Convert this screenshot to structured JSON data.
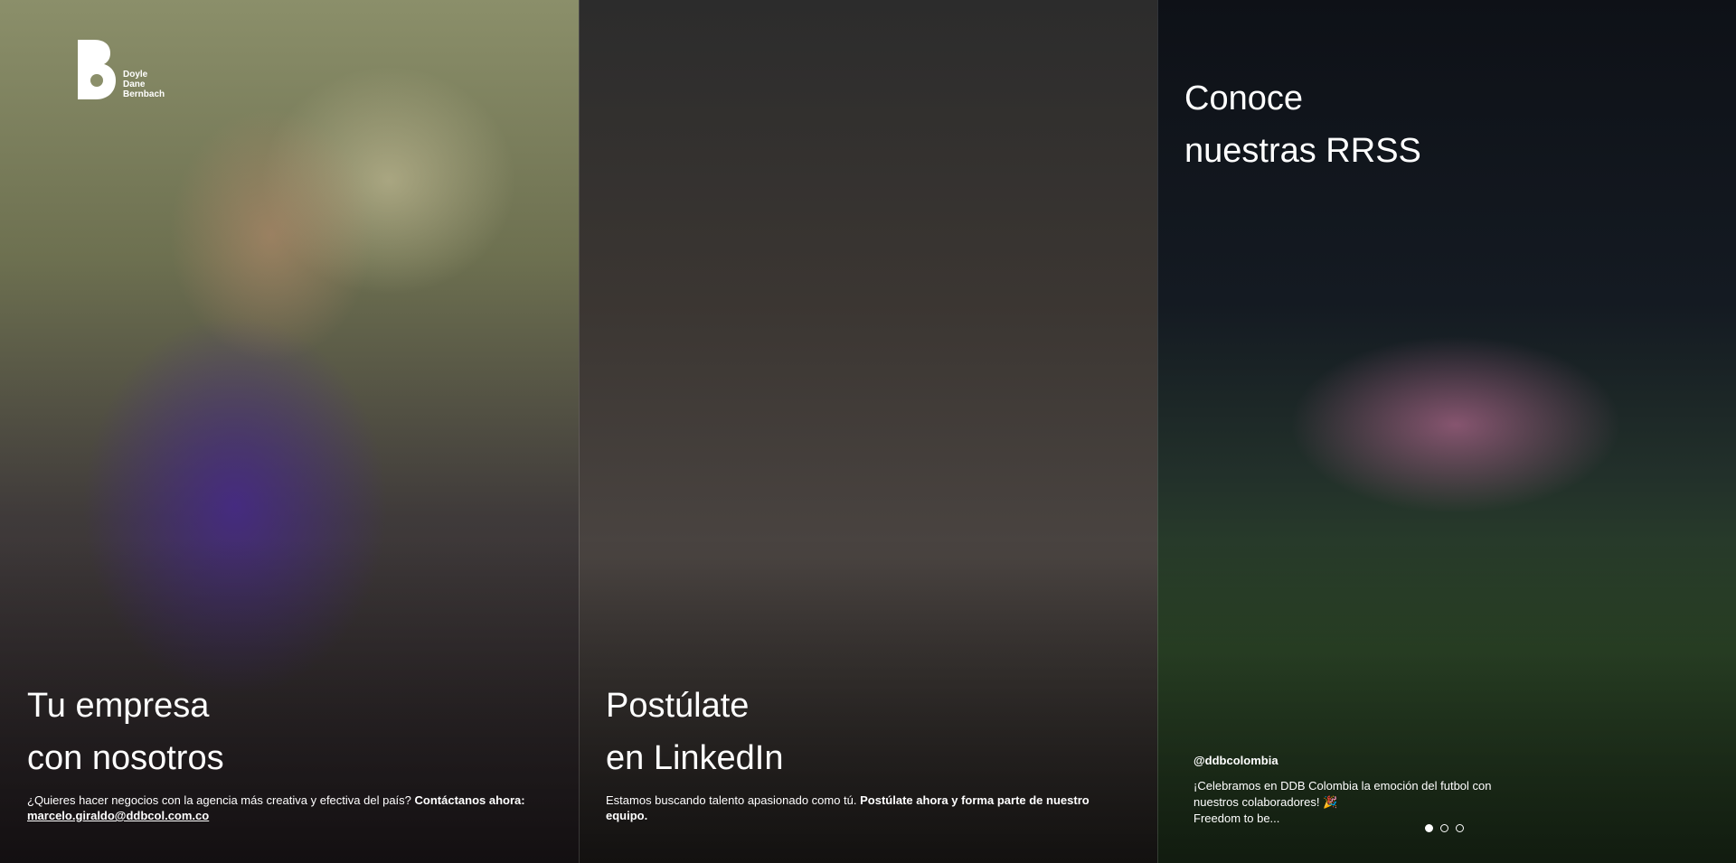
{
  "logo": {
    "lines": [
      "Doyle",
      "Dane",
      "Bernbach"
    ]
  },
  "panels": [
    {
      "title_lines": [
        "Tu empresa",
        "con nosotros"
      ],
      "desc_text": "¿Quieres hacer negocios con la agencia más creativa y efectiva del país? ",
      "desc_bold": "Contáctanos ahora: ",
      "email": "marcelo.giraldo@ddbcol.com.co"
    },
    {
      "title_lines": [
        "Postúlate",
        "en LinkedIn"
      ],
      "desc_text": "Estamos buscando talento apasionado como tú. ",
      "desc_bold": "Postúlate ahora y forma parte de nuestro equipo."
    },
    {
      "title_lines": [
        "Conoce",
        "nuestras RRSS"
      ],
      "handle": "@ddbcolombia",
      "caption": "¡Celebramos en DDB Colombia la emoción del futbol con nuestros colaboradores! 🎉\nFreedom to be...",
      "carousel": {
        "count": 3,
        "active": 1
      }
    }
  ],
  "icons": [
    "ddb-logo-icon"
  ]
}
